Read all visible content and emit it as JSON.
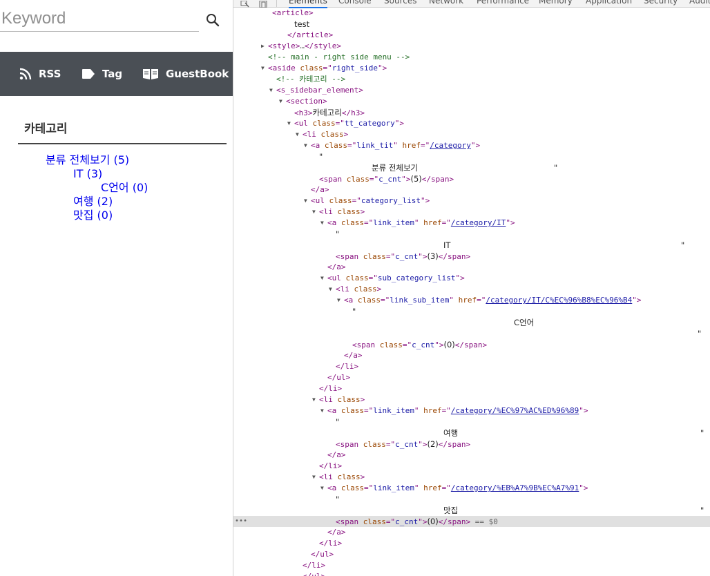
{
  "search": {
    "placeholder": "Keyword"
  },
  "menu": {
    "rss": "RSS",
    "tag": "Tag",
    "guestbook": "GuestBook"
  },
  "sidebar": {
    "heading": "카테고리",
    "all": "분류 전체보기 (5)",
    "it": "IT (3)",
    "c_lang": "C언어 (0)",
    "travel": "여행 (2)",
    "food": "맛집 (0)"
  },
  "devtools": {
    "tabs": [
      "Elements",
      "Console",
      "Sources",
      "Network",
      "Performance",
      "Memory",
      "Application",
      "Security",
      "Audits"
    ],
    "lines": [
      {
        "tw": "",
        "parts": [
          [
            "t",
            "<"
          ],
          [
            "t",
            "article"
          ],
          [
            "t",
            ">"
          ]
        ]
      },
      {
        "tw": "",
        "parts": [
          [
            "x",
            "test"
          ]
        ]
      },
      {
        "tw": "",
        "parts": [
          [
            "t",
            "</article>"
          ]
        ]
      },
      {
        "tw": "right",
        "parts": [
          [
            "t",
            "<style>"
          ],
          [
            "d",
            "…"
          ],
          [
            "t",
            "</style>"
          ]
        ]
      },
      {
        "tw": "",
        "parts": [
          [
            "c",
            "<!-- main - right side menu -->"
          ]
        ]
      },
      {
        "tw": "down",
        "parts": [
          [
            "t",
            "<aside "
          ],
          [
            "a",
            "class"
          ],
          [
            "t",
            "=\""
          ],
          [
            "v",
            "right_side"
          ],
          [
            "t",
            "\">"
          ]
        ]
      },
      {
        "tw": "",
        "parts": [
          [
            "c",
            "<!-- 카테고리 -->"
          ]
        ]
      },
      {
        "tw": "down",
        "parts": [
          [
            "t",
            "<s_sidebar_element>"
          ]
        ]
      },
      {
        "tw": "down",
        "parts": [
          [
            "t",
            "<section>"
          ]
        ]
      },
      {
        "tw": "",
        "parts": [
          [
            "t",
            "<h3>"
          ],
          [
            "x",
            "카테고리"
          ],
          [
            "t",
            "</h3>"
          ]
        ]
      },
      {
        "tw": "down",
        "parts": [
          [
            "t",
            "<ul "
          ],
          [
            "a",
            "class"
          ],
          [
            "t",
            "=\""
          ],
          [
            "v",
            "tt_category"
          ],
          [
            "t",
            "\">"
          ]
        ]
      },
      {
        "tw": "down",
        "parts": [
          [
            "t",
            "<li "
          ],
          [
            "a",
            "class"
          ],
          [
            "t",
            ">"
          ]
        ]
      },
      {
        "tw": "down",
        "parts": [
          [
            "t",
            "<a "
          ],
          [
            "a",
            "class"
          ],
          [
            "t",
            "=\""
          ],
          [
            "v",
            "link_tit"
          ],
          [
            "t",
            "\" "
          ],
          [
            "a",
            "href"
          ],
          [
            "t",
            "=\""
          ],
          [
            "l",
            "/category"
          ],
          [
            "t",
            "\">"
          ]
        ]
      },
      {
        "tw": "",
        "parts": [
          [
            "x",
            "\""
          ]
        ]
      },
      {
        "tw": "",
        "parts": [
          [
            "x",
            "분류 전체보기"
          ],
          [
            "x2",
            "\""
          ]
        ]
      },
      {
        "tw": "",
        "parts": [
          [
            "t",
            "<span "
          ],
          [
            "a",
            "class"
          ],
          [
            "t",
            "=\""
          ],
          [
            "v",
            "c_cnt"
          ],
          [
            "t",
            "\">"
          ],
          [
            "x",
            "(5)"
          ],
          [
            "t",
            "</span>"
          ]
        ]
      },
      {
        "tw": "",
        "parts": [
          [
            "t",
            "</a>"
          ]
        ]
      },
      {
        "tw": "down",
        "parts": [
          [
            "t",
            "<ul "
          ],
          [
            "a",
            "class"
          ],
          [
            "t",
            "=\""
          ],
          [
            "v",
            "category_list"
          ],
          [
            "t",
            "\">"
          ]
        ]
      },
      {
        "tw": "down",
        "parts": [
          [
            "t",
            "<li "
          ],
          [
            "a",
            "class"
          ],
          [
            "t",
            ">"
          ]
        ]
      },
      {
        "tw": "down",
        "parts": [
          [
            "t",
            "<a "
          ],
          [
            "a",
            "class"
          ],
          [
            "t",
            "=\""
          ],
          [
            "v",
            "link_item"
          ],
          [
            "t",
            "\" "
          ],
          [
            "a",
            "href"
          ],
          [
            "t",
            "=\""
          ],
          [
            "l",
            "/category/IT"
          ],
          [
            "t",
            "\">"
          ]
        ]
      },
      {
        "tw": "",
        "parts": [
          [
            "x",
            "\""
          ]
        ]
      },
      {
        "tw": "",
        "parts": [
          [
            "x",
            "IT"
          ],
          [
            "x2",
            "\""
          ]
        ]
      },
      {
        "tw": "",
        "parts": [
          [
            "t",
            "<span "
          ],
          [
            "a",
            "class"
          ],
          [
            "t",
            "=\""
          ],
          [
            "v",
            "c_cnt"
          ],
          [
            "t",
            "\">"
          ],
          [
            "x",
            "(3)"
          ],
          [
            "t",
            "</span>"
          ]
        ]
      },
      {
        "tw": "",
        "parts": [
          [
            "t",
            "</a>"
          ]
        ]
      },
      {
        "tw": "down",
        "parts": [
          [
            "t",
            "<ul "
          ],
          [
            "a",
            "class"
          ],
          [
            "t",
            "=\""
          ],
          [
            "v",
            "sub_category_list"
          ],
          [
            "t",
            "\">"
          ]
        ]
      },
      {
        "tw": "down",
        "parts": [
          [
            "t",
            "<li "
          ],
          [
            "a",
            "class"
          ],
          [
            "t",
            ">"
          ]
        ]
      },
      {
        "tw": "down",
        "parts": [
          [
            "t",
            "<a "
          ],
          [
            "a",
            "class"
          ],
          [
            "t",
            "=\""
          ],
          [
            "v",
            "link_sub_item"
          ],
          [
            "t",
            "\" "
          ],
          [
            "a",
            "href"
          ],
          [
            "t",
            "=\""
          ],
          [
            "l",
            "/category/IT/C%EC%96%B8%EC%96%B4"
          ],
          [
            "t",
            "\">"
          ]
        ]
      },
      {
        "tw": "",
        "parts": [
          [
            "x",
            "\""
          ]
        ]
      },
      {
        "tw": "",
        "parts": [
          [
            "x",
            "C언어"
          ]
        ]
      },
      {
        "tw": "",
        "parts": [
          [
            "x2",
            "\""
          ]
        ]
      },
      {
        "tw": "",
        "parts": [
          [
            "t",
            "<span "
          ],
          [
            "a",
            "class"
          ],
          [
            "t",
            "=\""
          ],
          [
            "v",
            "c_cnt"
          ],
          [
            "t",
            "\">"
          ],
          [
            "x",
            "(0)"
          ],
          [
            "t",
            "</span>"
          ]
        ]
      },
      {
        "tw": "",
        "parts": [
          [
            "t",
            "</a>"
          ]
        ]
      },
      {
        "tw": "",
        "parts": [
          [
            "t",
            "</li>"
          ]
        ]
      },
      {
        "tw": "",
        "parts": [
          [
            "t",
            "</ul>"
          ]
        ]
      },
      {
        "tw": "",
        "parts": [
          [
            "t",
            "</li>"
          ]
        ]
      },
      {
        "tw": "down",
        "parts": [
          [
            "t",
            "<li "
          ],
          [
            "a",
            "class"
          ],
          [
            "t",
            ">"
          ]
        ]
      },
      {
        "tw": "down",
        "parts": [
          [
            "t",
            "<a "
          ],
          [
            "a",
            "class"
          ],
          [
            "t",
            "=\""
          ],
          [
            "v",
            "link_item"
          ],
          [
            "t",
            "\" "
          ],
          [
            "a",
            "href"
          ],
          [
            "t",
            "=\""
          ],
          [
            "l",
            "/category/%EC%97%AC%ED%96%89"
          ],
          [
            "t",
            "\">"
          ]
        ]
      },
      {
        "tw": "",
        "parts": [
          [
            "x",
            "\""
          ]
        ]
      },
      {
        "tw": "",
        "parts": [
          [
            "x",
            "여행"
          ],
          [
            "x2",
            "\""
          ]
        ]
      },
      {
        "tw": "",
        "parts": [
          [
            "t",
            "<span "
          ],
          [
            "a",
            "class"
          ],
          [
            "t",
            "=\""
          ],
          [
            "v",
            "c_cnt"
          ],
          [
            "t",
            "\">"
          ],
          [
            "x",
            "(2)"
          ],
          [
            "t",
            "</span>"
          ]
        ]
      },
      {
        "tw": "",
        "parts": [
          [
            "t",
            "</a>"
          ]
        ]
      },
      {
        "tw": "",
        "parts": [
          [
            "t",
            "</li>"
          ]
        ]
      },
      {
        "tw": "down",
        "parts": [
          [
            "t",
            "<li "
          ],
          [
            "a",
            "class"
          ],
          [
            "t",
            ">"
          ]
        ]
      },
      {
        "tw": "down",
        "parts": [
          [
            "t",
            "<a "
          ],
          [
            "a",
            "class"
          ],
          [
            "t",
            "=\""
          ],
          [
            "v",
            "link_item"
          ],
          [
            "t",
            "\" "
          ],
          [
            "a",
            "href"
          ],
          [
            "t",
            "=\""
          ],
          [
            "l",
            "/category/%EB%A7%9B%EC%A7%91"
          ],
          [
            "t",
            "\">"
          ]
        ]
      },
      {
        "tw": "",
        "parts": [
          [
            "x",
            "\""
          ]
        ]
      },
      {
        "tw": "",
        "parts": [
          [
            "x",
            "맛집"
          ],
          [
            "x2",
            "\""
          ]
        ]
      },
      {
        "tw": "",
        "parts": [
          [
            "t",
            "<span "
          ],
          [
            "a",
            "class"
          ],
          [
            "t",
            "=\""
          ],
          [
            "v",
            "c_cnt"
          ],
          [
            "t",
            "\">"
          ],
          [
            "x",
            "(0)"
          ],
          [
            "t",
            "</span>"
          ],
          [
            "d",
            " == $0"
          ]
        ]
      },
      {
        "tw": "",
        "parts": [
          [
            "t",
            "</a>"
          ]
        ]
      },
      {
        "tw": "",
        "parts": [
          [
            "t",
            "</li>"
          ]
        ]
      },
      {
        "tw": "",
        "parts": [
          [
            "t",
            "</ul>"
          ]
        ]
      },
      {
        "tw": "",
        "parts": [
          [
            "t",
            "</li>"
          ]
        ]
      },
      {
        "tw": "",
        "parts": [
          [
            "t",
            "</ul>"
          ]
        ]
      }
    ],
    "selected_dots": "•••"
  },
  "colors": {
    "menu_bg": "#4a4f55",
    "link": "#0000ee",
    "tag": "#881280",
    "attr": "#994500",
    "value": "#1a1aa6",
    "comment": "#236e25"
  }
}
